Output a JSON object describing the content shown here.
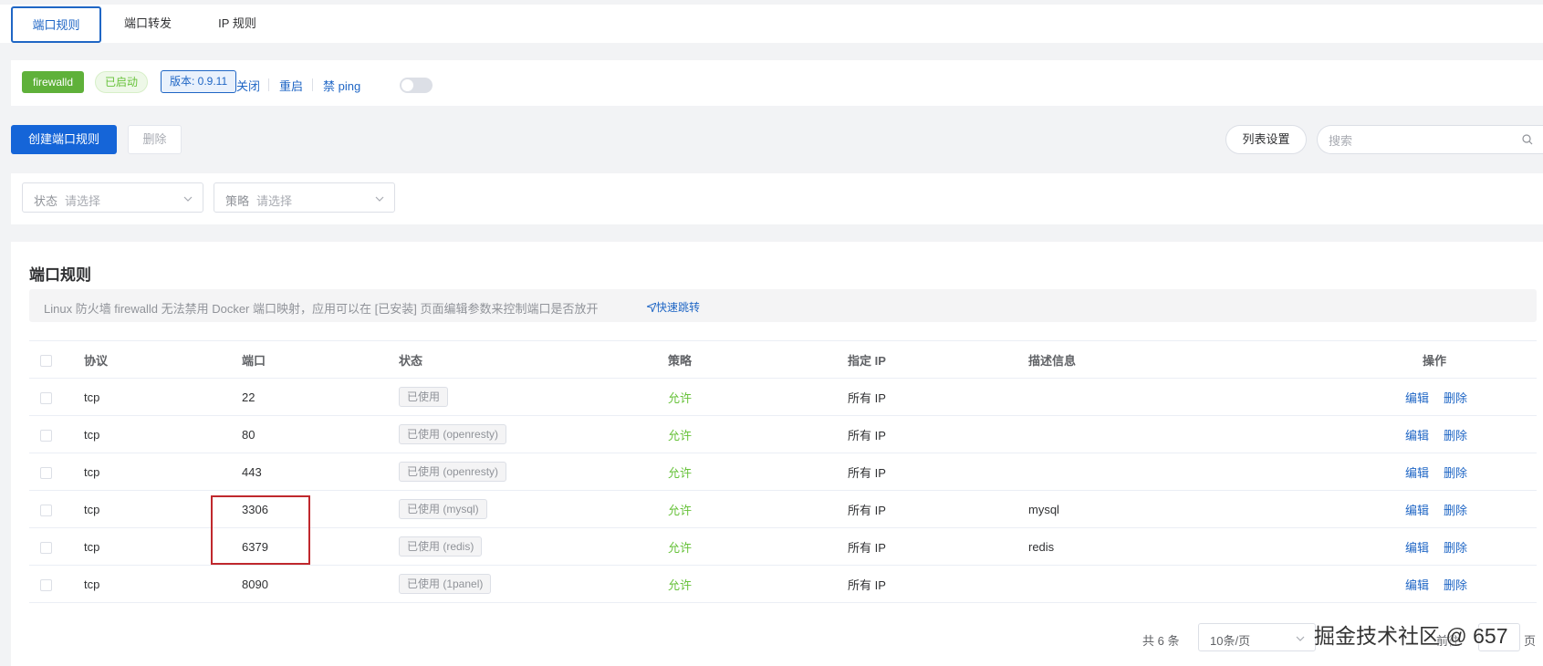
{
  "tabs": [
    {
      "label": "端口规则"
    },
    {
      "label": "端口转发"
    },
    {
      "label": "IP 规则"
    }
  ],
  "status": {
    "service": "firewalld",
    "state": "已启动",
    "version": "版本: 0.9.11",
    "stop": "关闭",
    "restart": "重启",
    "ping_label": "禁 ping",
    "ping_disabled": false
  },
  "actions": {
    "create": "创建端口规则",
    "delete": "删除",
    "columns": "列表设置",
    "search_placeholder": "搜索"
  },
  "filters": {
    "status_label": "状态",
    "status_placeholder": "请选择",
    "policy_label": "策略",
    "policy_placeholder": "请选择"
  },
  "panel": {
    "title": "端口规则",
    "notice": "Linux 防火墙 firewalld 无法禁用 Docker 端口映射，应用可以在 [已安装] 页面编辑参数来控制端口是否放开",
    "notice_link": "快速跳转"
  },
  "table": {
    "headers": [
      "协议",
      "端口",
      "状态",
      "策略",
      "指定 IP",
      "描述信息",
      "操作"
    ],
    "rows": [
      {
        "protocol": "tcp",
        "port": "22",
        "status": "已使用",
        "policy": "允许",
        "ip": "所有 IP",
        "desc": ""
      },
      {
        "protocol": "tcp",
        "port": "80",
        "status": "已使用 (openresty)",
        "policy": "允许",
        "ip": "所有 IP",
        "desc": ""
      },
      {
        "protocol": "tcp",
        "port": "443",
        "status": "已使用 (openresty)",
        "policy": "允许",
        "ip": "所有 IP",
        "desc": ""
      },
      {
        "protocol": "tcp",
        "port": "3306",
        "status": "已使用 (mysql)",
        "policy": "允许",
        "ip": "所有 IP",
        "desc": "mysql"
      },
      {
        "protocol": "tcp",
        "port": "6379",
        "status": "已使用 (redis)",
        "policy": "允许",
        "ip": "所有 IP",
        "desc": "redis"
      },
      {
        "protocol": "tcp",
        "port": "8090",
        "status": "已使用 (1panel)",
        "policy": "允许",
        "ip": "所有 IP",
        "desc": ""
      }
    ],
    "op_edit": "编辑",
    "op_delete": "删除"
  },
  "pagination": {
    "total": "共 6 条",
    "page_size": "10条/页",
    "goto_prefix": "前往",
    "goto_value": "",
    "goto_suffix": "页"
  },
  "watermark": "掘金技术社区 @ 657",
  "colors": {
    "primary": "#1565d8",
    "link": "#1f66c5",
    "success": "#67c23a",
    "highlight_box": "#c0282d"
  }
}
